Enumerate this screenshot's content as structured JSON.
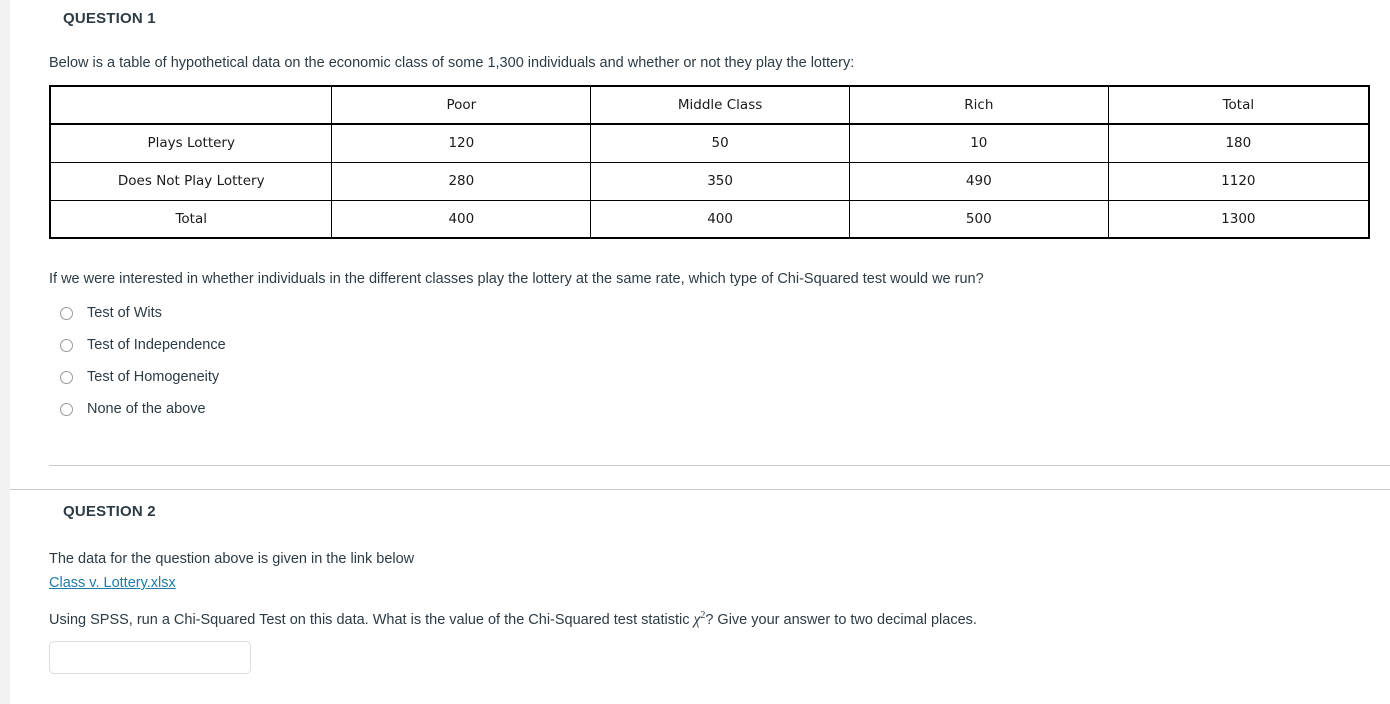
{
  "questions": [
    {
      "heading": "QUESTION 1",
      "intro": "Below is a table of hypothetical data on the economic class of some 1,300 individuals and whether or not they play the lottery:",
      "prompt": "If we were interested in whether individuals in the different classes play the lottery at the same rate, which type of Chi-Squared test would we run?",
      "options": [
        "Test of Wits",
        "Test of Independence",
        "Test of Homogeneity",
        "None of the above"
      ]
    },
    {
      "heading": "QUESTION 2",
      "line1": "The data for the question above is given in the link below",
      "file_link": "Class v. Lottery.xlsx",
      "line2_before": "Using SPSS, run a Chi-Squared Test on this data. What is the value of the Chi-Squared test statistic ",
      "chi_symbol": "χ",
      "chi_exponent": "2",
      "line2_after": "? Give your answer to two decimal places.",
      "answer_value": "",
      "answer_placeholder": ""
    }
  ],
  "table": {
    "corner_label": "",
    "headers": [
      "",
      "Poor",
      "Middle Class",
      "Rich",
      "Total"
    ],
    "rows": [
      {
        "label": "Plays Lottery",
        "cells": [
          "120",
          "50",
          "10",
          "180"
        ]
      },
      {
        "label": "Does Not Play Lottery",
        "cells": [
          "280",
          "350",
          "490",
          "1120"
        ]
      },
      {
        "label": "Total",
        "cells": [
          "400",
          "400",
          "500",
          "1300"
        ]
      }
    ]
  },
  "colors": {
    "link": "#1f7ba8",
    "text": "#2d3b45",
    "rule": "#c7cdd1",
    "table_border": "#000000",
    "page_background": "#f2f2f2"
  }
}
